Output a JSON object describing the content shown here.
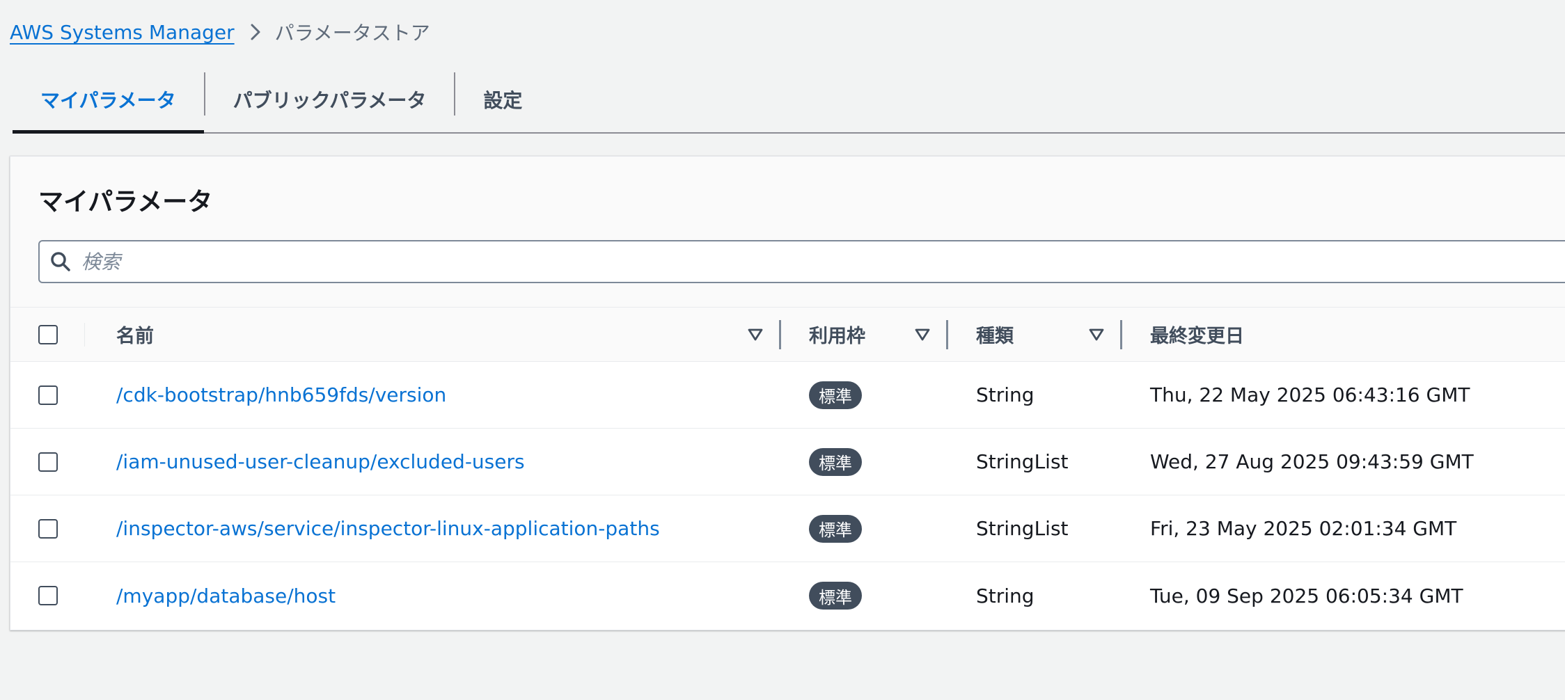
{
  "breadcrumb": {
    "root": "AWS Systems Manager",
    "current": "パラメータストア"
  },
  "tabs": [
    {
      "label": "マイパラメータ",
      "active": true
    },
    {
      "label": "パブリックパラメータ",
      "active": false
    },
    {
      "label": "設定",
      "active": false
    }
  ],
  "panel": {
    "title": "マイパラメータ",
    "search_placeholder": "検索"
  },
  "table": {
    "columns": {
      "name": "名前",
      "usage": "利用枠",
      "type": "種類",
      "last_modified": "最終変更日"
    },
    "rows": [
      {
        "name": "/cdk-bootstrap/hnb659fds/version",
        "tier": "標準",
        "type": "String",
        "last_modified": "Thu, 22 May 2025 06:43:16 GMT"
      },
      {
        "name": "/iam-unused-user-cleanup/excluded-users",
        "tier": "標準",
        "type": "StringList",
        "last_modified": "Wed, 27 Aug 2025 09:43:59 GMT"
      },
      {
        "name": "/inspector-aws/service/inspector-linux-application-paths",
        "tier": "標準",
        "type": "StringList",
        "last_modified": "Fri, 23 May 2025 02:01:34 GMT"
      },
      {
        "name": "/myapp/database/host",
        "tier": "標準",
        "type": "String",
        "last_modified": "Tue, 09 Sep 2025 06:05:34 GMT"
      }
    ]
  },
  "colors": {
    "link": "#0972d3",
    "badge_bg": "#414d5c",
    "page_bg": "#f2f3f3"
  },
  "icons": {
    "breadcrumb_separator": "chevron-right-icon",
    "search": "search-icon",
    "sort": "caret-down-outline-icon"
  }
}
